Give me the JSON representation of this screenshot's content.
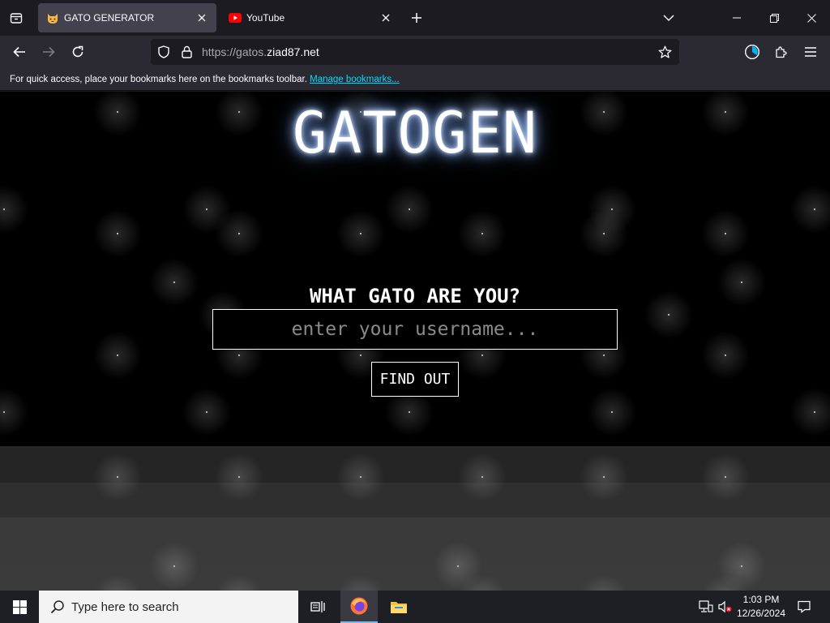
{
  "browser": {
    "tabs": [
      {
        "title": "GATO GENERATOR",
        "favicon": "cat-face-icon",
        "active": true
      },
      {
        "title": "YouTube",
        "favicon": "youtube-icon",
        "active": false
      }
    ],
    "url": {
      "protocol": "https://",
      "subdomain": "gatos.",
      "domain": "ziad87.net"
    },
    "bookmarks_bar": {
      "message": "For quick access, place your bookmarks here on the bookmarks toolbar.",
      "link": "Manage bookmarks..."
    },
    "colors": {
      "tabstrip": "#1c1b22",
      "toolbar": "#2b2a33",
      "active_tab": "#42414d",
      "link": "#00ddff"
    }
  },
  "page": {
    "title": "GATOGEN",
    "question": "WHAT GATO ARE YOU?",
    "input_placeholder": "enter your username...",
    "button_label": "FIND OUT",
    "colors": {
      "background": "#000000",
      "text": "#ffffff",
      "glow": "#9ec2ff"
    }
  },
  "taskbar": {
    "search_placeholder": "Type here to search",
    "time": "1:03 PM",
    "date": "12/26/2024",
    "pinned": [
      "task-view-icon",
      "firefox-icon",
      "file-explorer-icon"
    ]
  }
}
